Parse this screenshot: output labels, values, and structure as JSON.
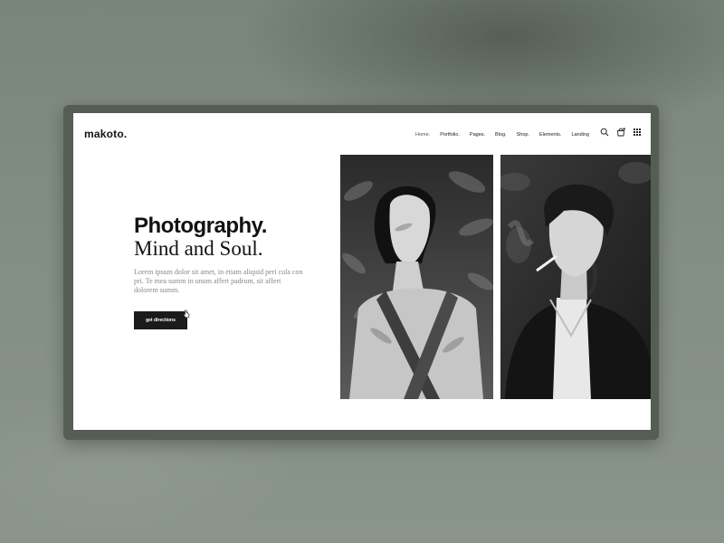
{
  "site": {
    "logo": "makoto.",
    "nav": [
      {
        "label": "Home."
      },
      {
        "label": "Portfolio."
      },
      {
        "label": "Pages."
      },
      {
        "label": "Blog."
      },
      {
        "label": "Shop."
      },
      {
        "label": "Elements."
      },
      {
        "label": "Landing"
      }
    ],
    "icons": [
      "search-icon",
      "cart-icon",
      "grid-menu-icon"
    ]
  },
  "hero": {
    "title": "Photography.",
    "subtitle": "Mind and Soul.",
    "text": "Lorem ipsum dolor sit amet, in etiam aliquid peri cula con pri. Te mea summ in unum affert padrum, sit affert dolorem summ.",
    "cta_label": "get directions"
  },
  "colors": {
    "background": "#7f8a7f",
    "frame": "#555d55",
    "screen": "#ffffff",
    "button": "#1b1b1b"
  }
}
